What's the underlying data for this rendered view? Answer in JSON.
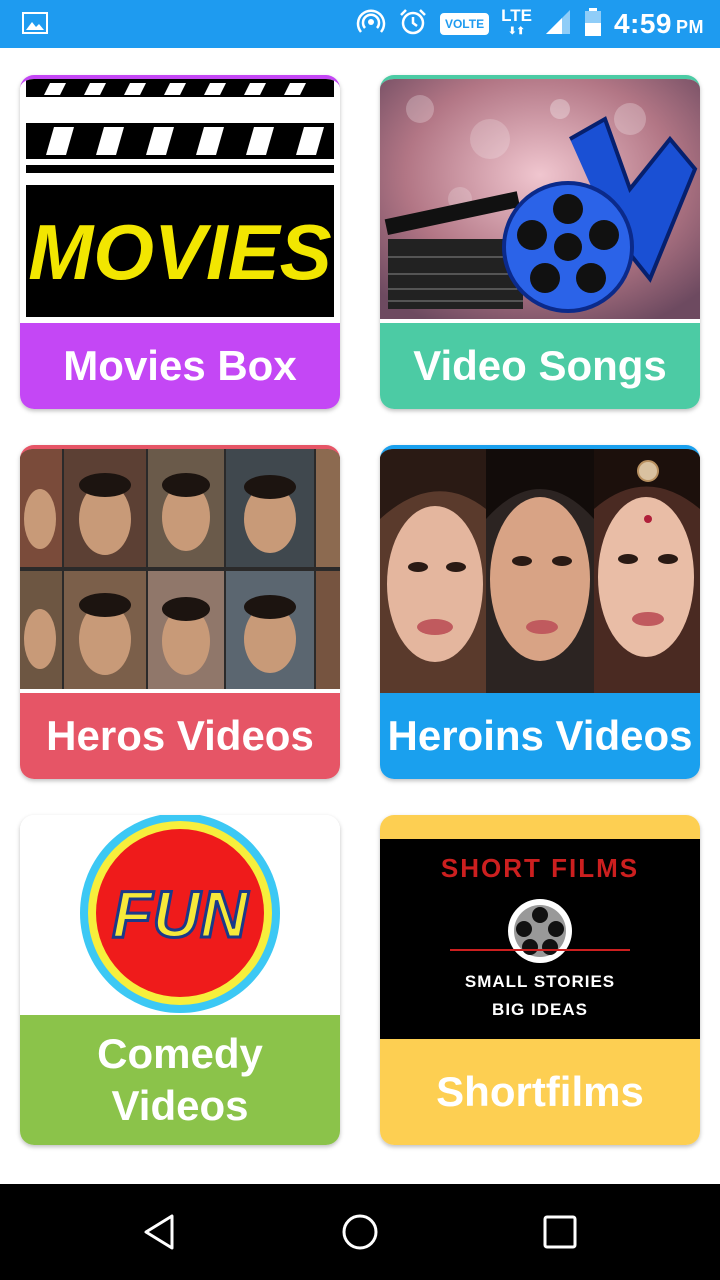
{
  "status_bar": {
    "time": "4:59",
    "ampm": "PM",
    "volte": "VOLTE",
    "lte": "LTE",
    "icons": [
      "image-icon",
      "hotspot-icon",
      "alarm-icon",
      "signal-icon",
      "battery-icon"
    ]
  },
  "cards": [
    {
      "label": "Movies  Box",
      "image_text": "MOVIES",
      "color": "#c447f5"
    },
    {
      "label": "Video Songs",
      "color": "#4ccba4"
    },
    {
      "label": "Heros Videos",
      "color": "#e65566"
    },
    {
      "label": "Heroins Videos",
      "color": "#1aa0ee"
    },
    {
      "label_line1": "Comedy",
      "label_line2": "Videos",
      "image_text": "FUN",
      "color": "#8bc34a"
    },
    {
      "label": "Shortfilms",
      "image_title": "SHORT FILMS",
      "image_line1": "SMALL STORIES",
      "image_line2": "BIG IDEAS",
      "color": "#fdcf52"
    }
  ],
  "nav_bar": {
    "icons": [
      "back-icon",
      "home-icon",
      "recents-icon"
    ]
  }
}
